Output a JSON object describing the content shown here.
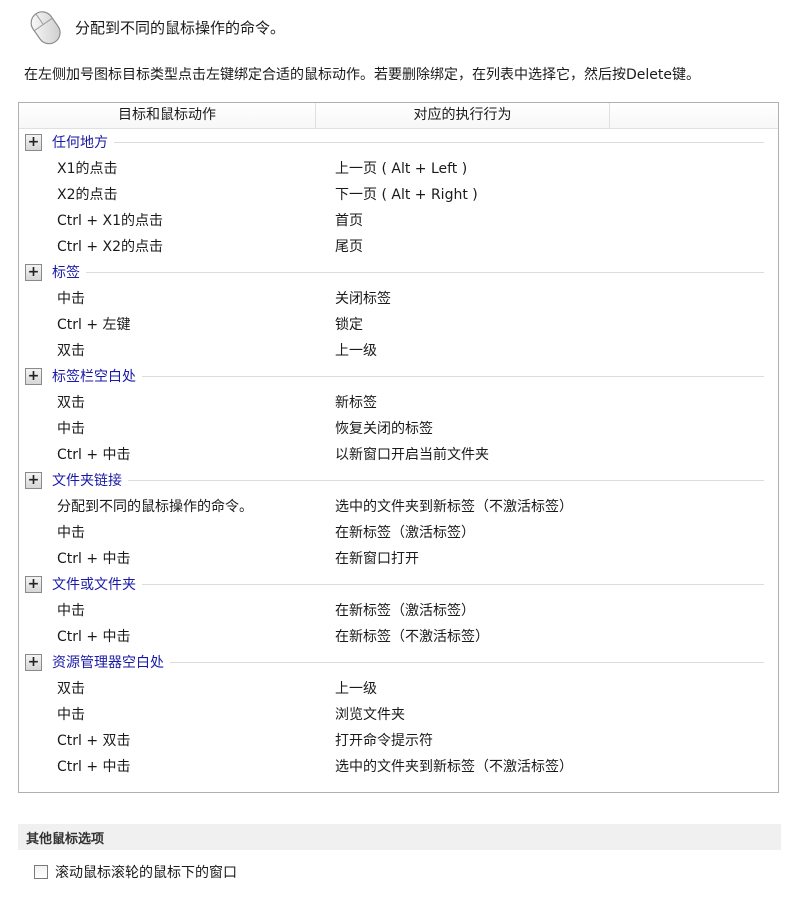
{
  "header": {
    "icon": "mouse-icon",
    "title": "分配到不同的鼠标操作的命令。"
  },
  "description": "在左侧加号图标目标类型点击左键绑定合适的鼠标动作。若要删除绑定，在列表中选择它，然后按Delete键。",
  "columns": [
    "目标和鼠标动作",
    "对应的执行行为",
    ""
  ],
  "groups": [
    {
      "label": "任何地方",
      "rows": [
        {
          "action": "X1的点击",
          "command": "上一页 ( Alt + Left )"
        },
        {
          "action": "X2的点击",
          "command": "下一页 ( Alt + Right )"
        },
        {
          "action": "Ctrl + X1的点击",
          "command": "首页"
        },
        {
          "action": "Ctrl + X2的点击",
          "command": "尾页"
        }
      ]
    },
    {
      "label": "标签",
      "rows": [
        {
          "action": "中击",
          "command": "关闭标签"
        },
        {
          "action": "Ctrl + 左键",
          "command": "锁定"
        },
        {
          "action": "双击",
          "command": "上一级"
        }
      ]
    },
    {
      "label": "标签栏空白处",
      "rows": [
        {
          "action": "双击",
          "command": "新标签"
        },
        {
          "action": "中击",
          "command": "恢复关闭的标签"
        },
        {
          "action": "Ctrl + 中击",
          "command": "以新窗口开启当前文件夹"
        }
      ]
    },
    {
      "label": "文件夹链接",
      "rows": [
        {
          "action": "分配到不同的鼠标操作的命令。",
          "command": "选中的文件夹到新标签（不激活标签）"
        },
        {
          "action": "中击",
          "command": "在新标签（激活标签）"
        },
        {
          "action": "Ctrl + 中击",
          "command": "在新窗口打开"
        }
      ]
    },
    {
      "label": "文件或文件夹",
      "rows": [
        {
          "action": "中击",
          "command": "在新标签（激活标签）"
        },
        {
          "action": "Ctrl + 中击",
          "command": "在新标签（不激活标签）"
        }
      ]
    },
    {
      "label": "资源管理器空白处",
      "rows": [
        {
          "action": "双击",
          "command": "上一级"
        },
        {
          "action": "中击",
          "command": "浏览文件夹"
        },
        {
          "action": "Ctrl + 双击",
          "command": "打开命令提示符"
        },
        {
          "action": "Ctrl + 中击",
          "command": "选中的文件夹到新标签（不激活标签）"
        }
      ]
    }
  ],
  "expander_symbol": "+",
  "other_section": {
    "title": "其他鼠标选项",
    "checkbox_label": "滚动鼠标滚轮的鼠标下的窗口",
    "checked": false
  }
}
